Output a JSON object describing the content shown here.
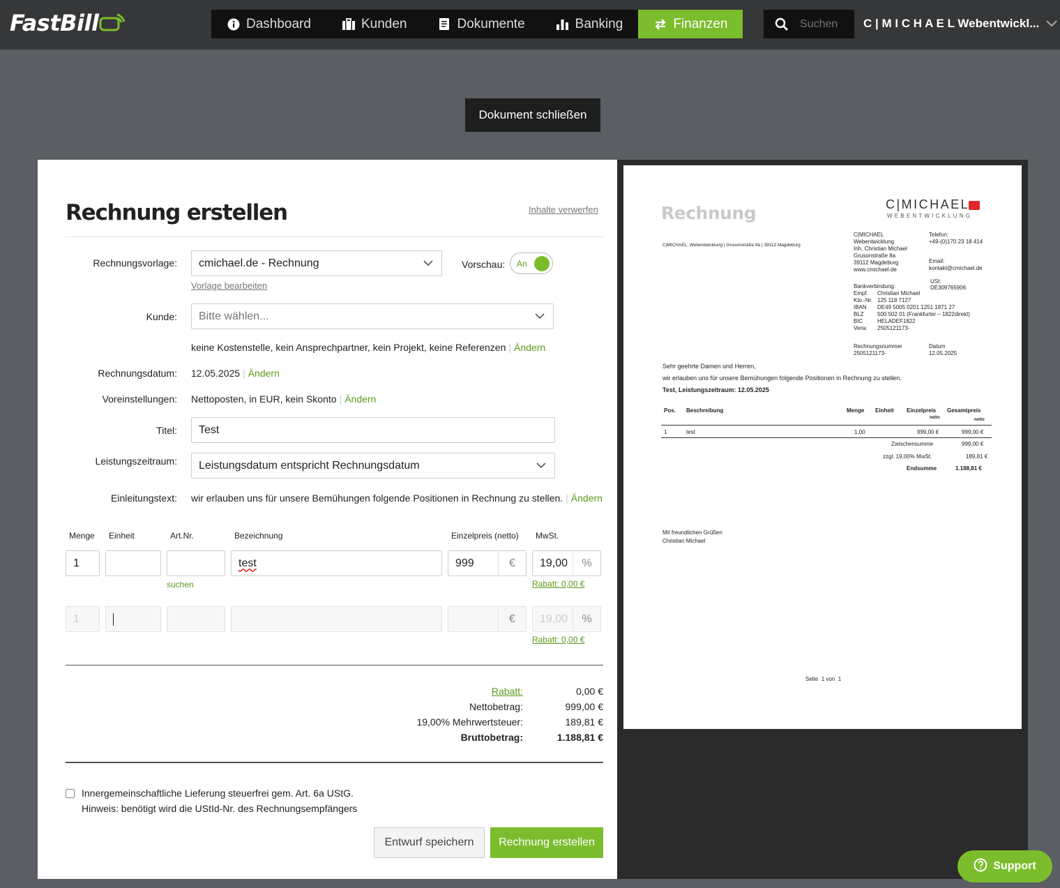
{
  "app": {
    "logo": "FastBill",
    "nav": [
      {
        "label": "Dashboard",
        "icon": "info-icon"
      },
      {
        "label": "Kunden",
        "icon": "briefcase-icon"
      },
      {
        "label": "Dokumente",
        "icon": "document-icon"
      },
      {
        "label": "Banking",
        "icon": "bar-chart-icon"
      },
      {
        "label": "Finanzen",
        "icon": "transfer-arrows-icon",
        "active": true
      }
    ],
    "search_placeholder": "Suchen",
    "account": "C | M I C H A E L Webentwickl...",
    "accent_color": "#7bbd2d"
  },
  "close_button": "Dokument schließen",
  "form": {
    "title": "Rechnung erstellen",
    "discard": "Inhalte verwerfen",
    "template_label": "Rechnungsvorlage:",
    "template_value": "cmichael.de - Rechnung",
    "edit_template": "Vorlage bearbeiten",
    "preview_label": "Vorschau:",
    "preview_toggle": "An",
    "customer_label": "Kunde:",
    "customer_placeholder": "Bitte wählen...",
    "customer_info": "keine Kostenstelle, kein Ansprechpartner, kein Projekt, keine Referenzen",
    "change": "Ändern",
    "date_label": "Rechnungsdatum:",
    "date_value": "12.05.2025",
    "presets_label": "Voreinstellungen:",
    "presets_value": "Nettoposten, in EUR, kein Skonto",
    "title_label": "Titel:",
    "title_value": "Test",
    "period_label": "Leistungszeitraum:",
    "period_value": "Leistungsdatum entspricht Rechnungsdatum",
    "intro_label": "Einleitungstext:",
    "intro_value": "wir erlauben uns für unsere Bemühungen folgende Positionen in Rechnung zu stellen.",
    "columns": {
      "qty": "Menge",
      "unit": "Einheit",
      "art": "Art.Nr.",
      "desc": "Bezeichnung",
      "price": "Einzelpreis (netto)",
      "vat": "MwSt."
    },
    "line1": {
      "qty": "1",
      "desc": "test",
      "price": "999",
      "currency": "€",
      "vat": "19,00",
      "pct": "%",
      "discount": "Rabatt: 0,00 €",
      "search": "suchen"
    },
    "line2": {
      "qty": "1",
      "currency": "€",
      "vat": "19,00",
      "pct": "%",
      "discount": "Rabatt: 0,00 €"
    },
    "totals": {
      "discount_label": "Rabatt:",
      "discount_value": "0,00 €",
      "net_label": "Nettobetrag:",
      "net_value": "999,00 €",
      "vat_label": "19,00% Mehrwertsteuer:",
      "vat_value": "189,81 €",
      "gross_label": "Bruttobetrag:",
      "gross_value": "1.188,81 €"
    },
    "intra_eu_label": "Innergemeinschaftliche Lieferung steuerfrei gem. Art. 6a UStG.",
    "intra_eu_hint": "Hinweis: benötigt wird die UStId-Nr. des Rechnungsempfängers",
    "save_draft": "Entwurf speichern",
    "create": "Rechnung erstellen"
  },
  "preview": {
    "title": "Rechnung",
    "brand": "C|MICHAEL",
    "brand_sub": "WEBENTWICKLUNG",
    "sender_line": "C|MICHAEL, Webentwicklung | Grusonstraße 8a | 39112 Magdeburg",
    "address": [
      "C|MICHAEL",
      "Webentwicklung",
      "Inh. Christian Michael",
      "Grusonstraße 8a",
      "39112 Magdeburg",
      "www.cmichael.de"
    ],
    "phone_label": "Telefon:",
    "phone": "+49-(0)170 23 18 414",
    "email_label": "Email:",
    "email": "kontakt@cmichael.de",
    "ust_label": "USt:",
    "ust": "DE309765906",
    "bank_label": "Bankverbindung:",
    "bank": [
      {
        "k": "Empf.",
        "v": "Christian Michael"
      },
      {
        "k": "Kto.-Nr.",
        "v": "125 118 7127"
      },
      {
        "k": "IBAN",
        "v": "DE49 5005 0201 1251 1871 27"
      },
      {
        "k": "BLZ",
        "v": "500 502 01 (Frankfurter – 1822direkt)"
      },
      {
        "k": "BIC",
        "v": "HELADEF1822"
      },
      {
        "k": "Verw.",
        "v": "2505121173-"
      }
    ],
    "invno_label": "Rechnungsnummer",
    "invno": "2505121173-",
    "date_label": "Datum",
    "date": "12.05.2025",
    "greeting": "Sehr geehrte Damen und Herren,",
    "intro": "wir erlauben uns für unsere Bemühungen folgende Positionen in Rechnung zu stellen.",
    "subject": "Test, Leistungszeitraum: 12.05.2025",
    "th": {
      "pos": "Pos.",
      "desc": "Beschreibung",
      "qty": "Menge",
      "unit": "Einheit",
      "price": "Einzelpreis",
      "price_sub": "netto",
      "total": "Gesamtpreis",
      "total_sub": "netto"
    },
    "row": {
      "pos": "1",
      "desc": "test",
      "qty": "1,00",
      "price": "999,00 €",
      "total": "999,00 €"
    },
    "subtotal_label": "Zwischensumme",
    "subtotal": "999,00 €",
    "vat_label": "zzgl. 19,00% MwSt.",
    "vat": "189,81 €",
    "end_label": "Endsumme",
    "end": "1.188,81 €",
    "closing": "Mit freundlichen Grüßen",
    "signer": "Christian Michael",
    "page_word": "Seite",
    "page": "1",
    "of_word": "von",
    "pages": "1"
  },
  "support": "Support"
}
